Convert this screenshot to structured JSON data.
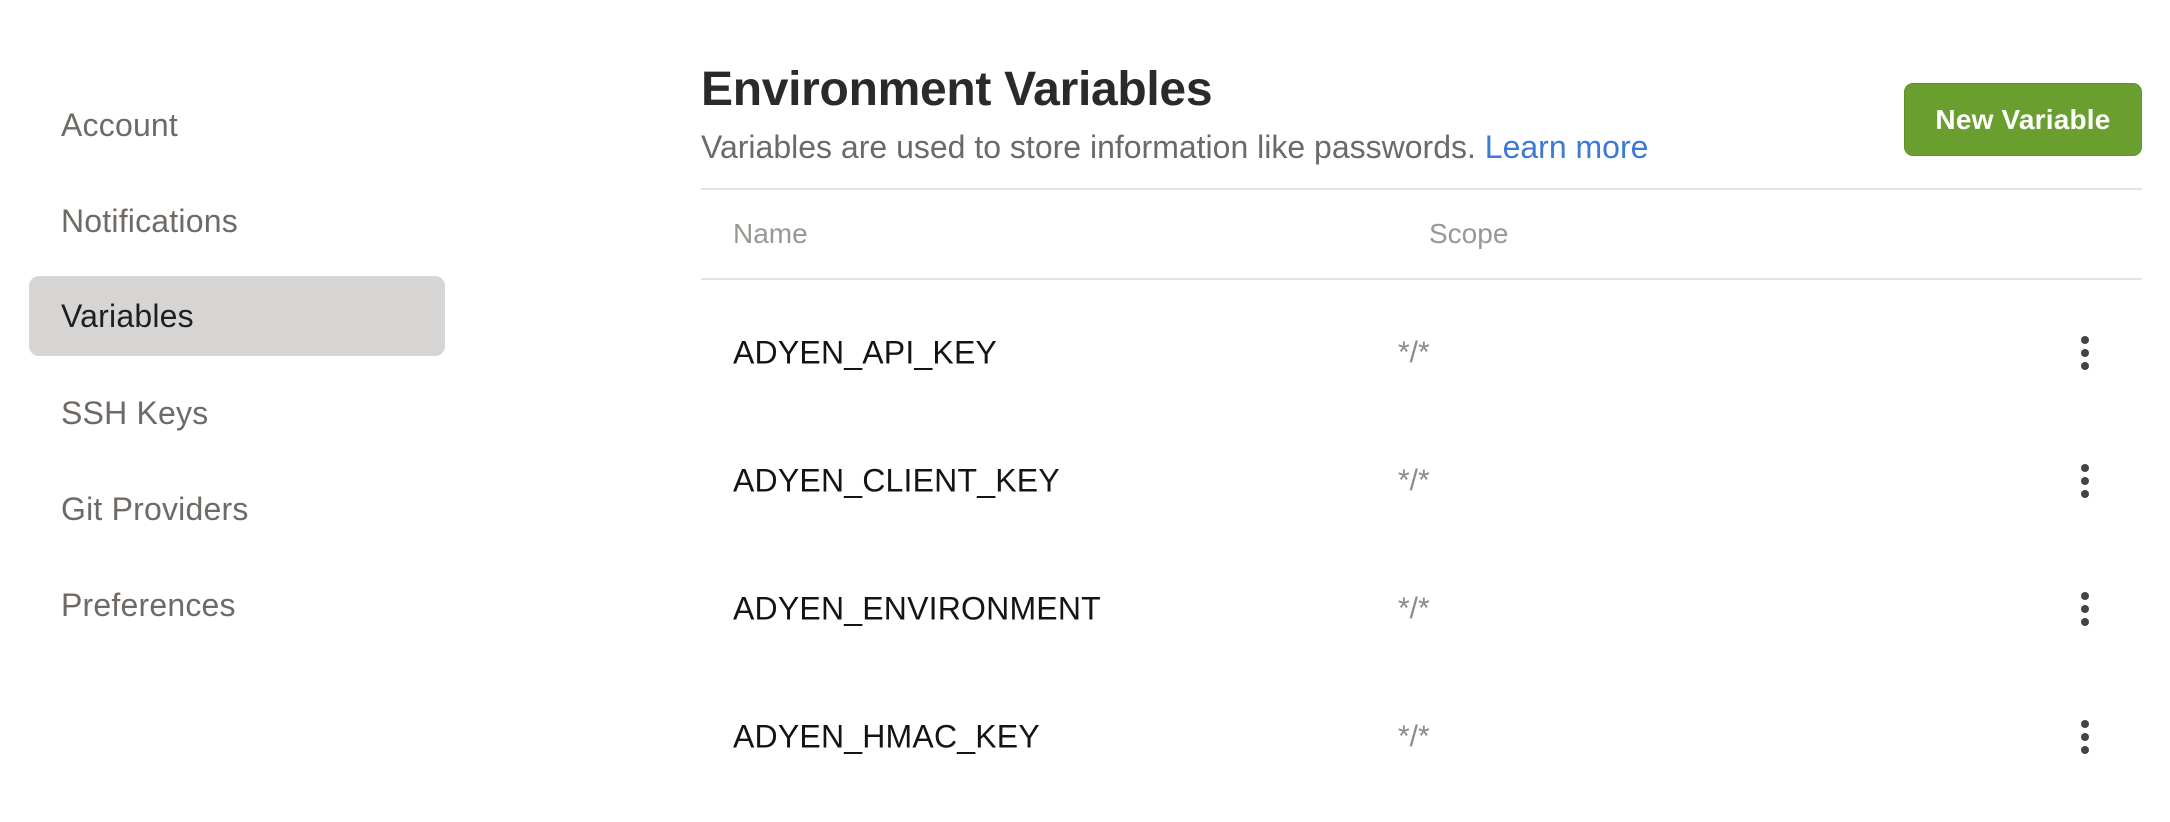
{
  "sidebar": {
    "items": [
      {
        "label": "Account"
      },
      {
        "label": "Notifications"
      },
      {
        "label": "Variables",
        "active": true
      },
      {
        "label": "SSH Keys"
      },
      {
        "label": "Git Providers"
      },
      {
        "label": "Preferences"
      }
    ]
  },
  "header": {
    "title": "Environment Variables",
    "subtitle": "Variables are used to store information like passwords.",
    "learn_more": "Learn more",
    "new_button": "New Variable"
  },
  "table": {
    "columns": [
      "Name",
      "Scope"
    ],
    "rows": [
      {
        "name": "ADYEN_API_KEY",
        "scope": "*/*"
      },
      {
        "name": "ADYEN_CLIENT_KEY",
        "scope": "*/*"
      },
      {
        "name": "ADYEN_ENVIRONMENT",
        "scope": "*/*"
      },
      {
        "name": "ADYEN_HMAC_KEY",
        "scope": "*/*"
      }
    ]
  },
  "colors": {
    "accent": "#6a9f2f",
    "link": "#3a7bd5",
    "active_bg": "#d6d5d3"
  },
  "icons": {
    "row_menu": "more-vertical-icon"
  }
}
